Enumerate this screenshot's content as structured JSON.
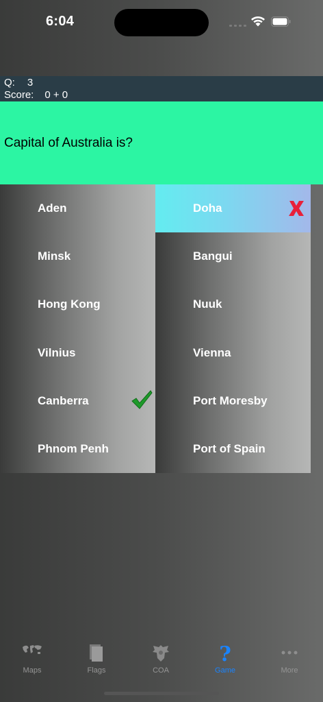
{
  "status": {
    "time": "6:04"
  },
  "info": {
    "q_label": "Q:",
    "q_value": "3",
    "score_label": "Score:",
    "score_value": "0 + 0"
  },
  "question": "Capital of Australia is?",
  "answers": {
    "left": [
      "Aden",
      "Minsk",
      "Hong Kong",
      "Vilnius",
      "Canberra",
      "Phnom Penh"
    ],
    "right": [
      "Doha",
      "Bangui",
      "Nuuk",
      "Vienna",
      "Port Moresby",
      "Port of Spain"
    ]
  },
  "result": {
    "selected": "Doha",
    "selected_state": "wrong",
    "correct": "Canberra"
  },
  "colors": {
    "question_bg": "#2cf5a3",
    "info_bg": "#2a3d47",
    "active_tab": "#1a84ff",
    "wrong_mark": "#e8203a",
    "correct_mark": "#1e9a2a"
  },
  "tabs": [
    {
      "label": "Maps",
      "icon": "world-map-icon"
    },
    {
      "label": "Flags",
      "icon": "flags-icon"
    },
    {
      "label": "COA",
      "icon": "coat-of-arms-icon"
    },
    {
      "label": "Game",
      "icon": "question-mark-icon",
      "active": true
    },
    {
      "label": "More",
      "icon": "more-dots-icon"
    }
  ]
}
